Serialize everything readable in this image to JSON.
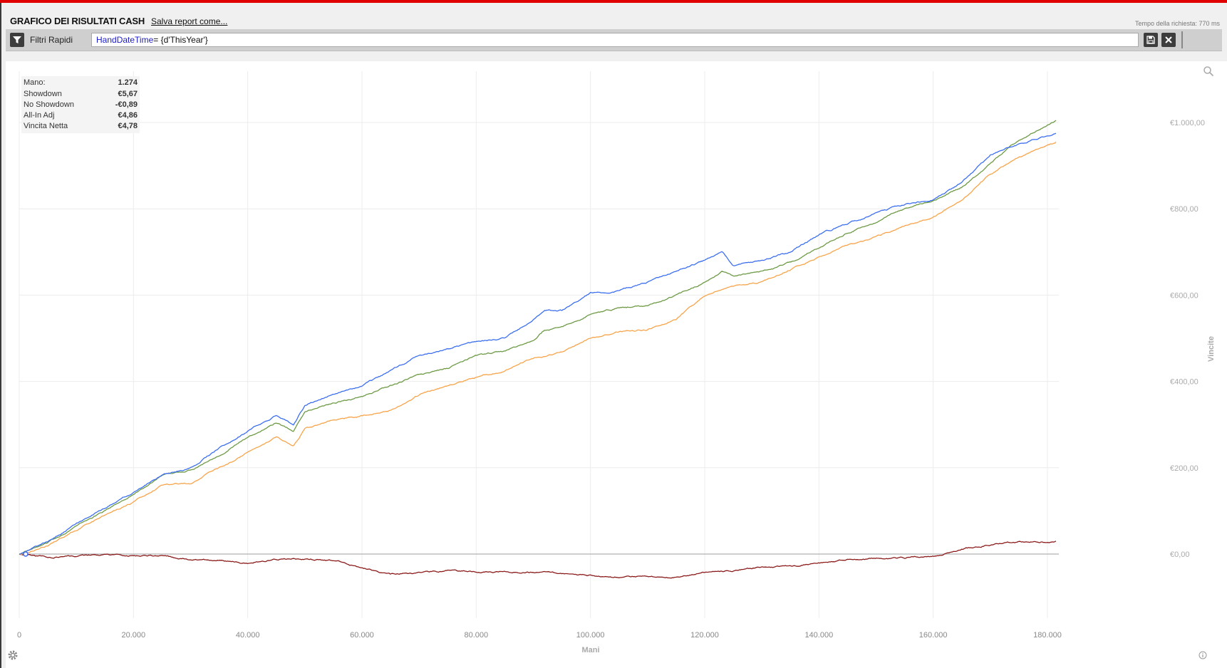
{
  "header": {
    "title": "GRAFICO DEI RISULTATI CASH",
    "save_link": "Salva report come...",
    "request_time": "Tempo della richiesta: 770 ms"
  },
  "filter_bar": {
    "label": "Filtri Rapidi",
    "filter_key": "HandDateTime",
    "filter_op": "= ",
    "filter_val": "{d'ThisYear'}"
  },
  "stats": [
    {
      "name": "Mano:",
      "value": "1.274"
    },
    {
      "name": "Showdown",
      "value": "€5,67"
    },
    {
      "name": "No Showdown",
      "value": "-€0,89"
    },
    {
      "name": "All-In Adj",
      "value": "€4,86"
    },
    {
      "name": "Vincita Netta",
      "value": "€4,78"
    }
  ],
  "colors": {
    "vincita_netta": "#6d9a45",
    "all_in_adj": "#3c6ff0",
    "showdown": "#f7a44a",
    "no_showdown": "#8b1a1a",
    "zero_line": "#b0b0b0",
    "grid": "#ececec"
  },
  "chart_data": {
    "type": "line",
    "xlabel": "Mani",
    "ylabel": "Vincite",
    "xlim": [
      0,
      182000
    ],
    "ylim": [
      -160,
      1100
    ],
    "x_ticks": [
      {
        "value": 0,
        "label": "0"
      },
      {
        "value": 20000,
        "label": "20.000"
      },
      {
        "value": 40000,
        "label": "40.000"
      },
      {
        "value": 60000,
        "label": "60.000"
      },
      {
        "value": 80000,
        "label": "80.000"
      },
      {
        "value": 100000,
        "label": "100.000"
      },
      {
        "value": 120000,
        "label": "120.000"
      },
      {
        "value": 140000,
        "label": "140.000"
      },
      {
        "value": 160000,
        "label": "160.000"
      },
      {
        "value": 180000,
        "label": "180.000"
      }
    ],
    "y_ticks": [
      {
        "value": 0,
        "label": "€0,00"
      },
      {
        "value": 200,
        "label": "€200,00"
      },
      {
        "value": 400,
        "label": "€400,00"
      },
      {
        "value": 600,
        "label": "€600,00"
      },
      {
        "value": 800,
        "label": "€800,00"
      },
      {
        "value": 1000,
        "label": "€1.000,00"
      }
    ],
    "grid": true,
    "x": [
      0,
      5000,
      10000,
      15000,
      20000,
      25000,
      30000,
      35000,
      40000,
      45000,
      48000,
      50000,
      55000,
      60000,
      65000,
      70000,
      75000,
      80000,
      85000,
      90000,
      92000,
      95000,
      100000,
      105000,
      110000,
      115000,
      120000,
      123000,
      125000,
      130000,
      135000,
      140000,
      145000,
      150000,
      155000,
      160000,
      165000,
      170000,
      175000,
      181500
    ],
    "series": [
      {
        "name": "Vincita Netta",
        "color": "#6d9a45",
        "values": [
          0,
          25,
          65,
          100,
          140,
          180,
          195,
          230,
          270,
          305,
          285,
          330,
          350,
          365,
          390,
          415,
          430,
          460,
          470,
          495,
          520,
          525,
          555,
          570,
          575,
          600,
          630,
          655,
          645,
          655,
          675,
          710,
          745,
          770,
          800,
          820,
          850,
          905,
          960,
          1005
        ]
      },
      {
        "name": "All-In Adj",
        "color": "#3c6ff0",
        "values": [
          0,
          30,
          70,
          105,
          145,
          185,
          200,
          245,
          285,
          320,
          300,
          345,
          370,
          390,
          425,
          460,
          475,
          490,
          500,
          545,
          565,
          565,
          605,
          610,
          630,
          655,
          680,
          700,
          670,
          680,
          700,
          740,
          765,
          790,
          810,
          820,
          860,
          925,
          950,
          975
        ]
      },
      {
        "name": "All-In Adj",
        "color": "#f7a44a",
        "values": [
          0,
          20,
          55,
          90,
          120,
          160,
          165,
          200,
          235,
          270,
          250,
          290,
          310,
          320,
          335,
          370,
          390,
          410,
          425,
          455,
          460,
          470,
          500,
          515,
          520,
          545,
          600,
          615,
          620,
          630,
          660,
          690,
          715,
          735,
          760,
          780,
          820,
          880,
          920,
          955
        ]
      },
      {
        "name": "No Showdown",
        "color": "#8b1a1a",
        "values": [
          0,
          -8,
          -5,
          -3,
          -3,
          -5,
          -13,
          -15,
          -22,
          -12,
          -10,
          -12,
          -15,
          -30,
          -47,
          -43,
          -38,
          -42,
          -40,
          -42,
          -43,
          -45,
          -50,
          -52,
          -52,
          -55,
          -42,
          -40,
          -38,
          -30,
          -28,
          -20,
          -14,
          -10,
          -8,
          -5,
          12,
          22,
          28,
          30
        ]
      }
    ]
  }
}
